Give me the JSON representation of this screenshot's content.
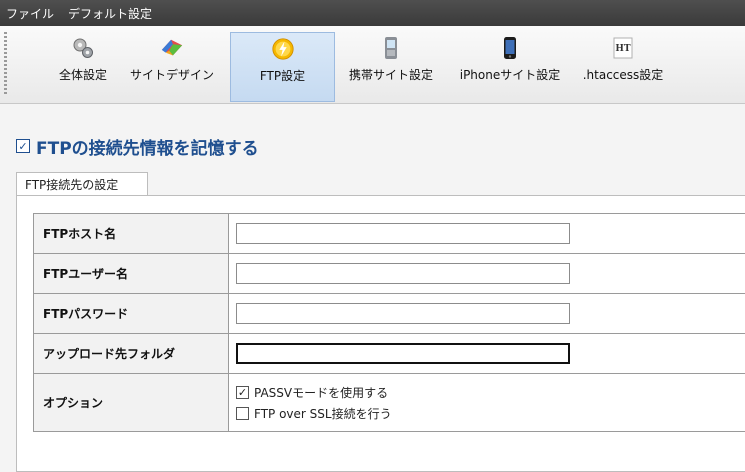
{
  "menubar": {
    "items": [
      "ファイル",
      "デフォルト設定"
    ]
  },
  "toolbar": {
    "items": [
      {
        "label": "全体設定",
        "icon": "gear-icon"
      },
      {
        "label": "サイトデザイン",
        "icon": "palette-icon"
      },
      {
        "label": "FTP設定",
        "icon": "ftp-bolt-icon",
        "active": true
      },
      {
        "label": "携帯サイト設定",
        "icon": "mobile-phone-icon"
      },
      {
        "label": "iPhoneサイト設定",
        "icon": "iphone-icon"
      },
      {
        "label": ".htaccess設定",
        "icon": "htaccess-icon",
        "icon_text": "HT"
      }
    ]
  },
  "section": {
    "remember_checked": true,
    "remember_label": "FTPの接続先情報を記憶する"
  },
  "tab": {
    "label": "FTP接続先の設定"
  },
  "form": {
    "host_label": "FTPホスト名",
    "host_value": "",
    "user_label": "FTPユーザー名",
    "user_value": "",
    "password_label": "FTPパスワード",
    "password_value": "",
    "folder_label": "アップロード先フォルダ",
    "folder_value": "",
    "options_label": "オプション",
    "pasv_label": "PASSVモードを使用する",
    "pasv_checked": true,
    "ssl_label": "FTP over SSL接続を行う",
    "ssl_checked": false
  },
  "colors": {
    "accent": "#1f4f8f",
    "menubar": "#3f3f3f",
    "active_tool": "#c5daf1"
  }
}
